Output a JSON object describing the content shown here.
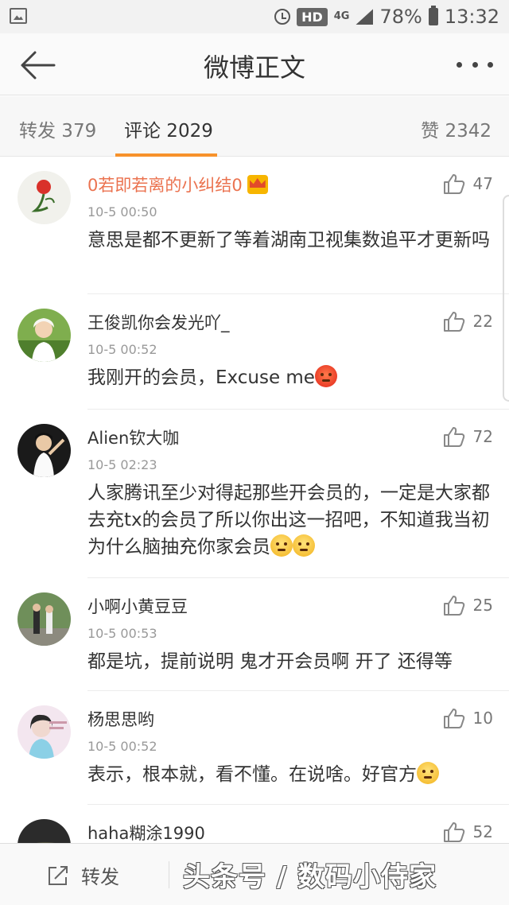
{
  "status_bar": {
    "hd": "HD",
    "network": "4G",
    "battery": "78%",
    "time": "13:32"
  },
  "nav": {
    "title": "微博正文",
    "back_icon": "back-arrow-icon",
    "more_icon": "more-icon"
  },
  "tabs": {
    "forward": "转发 379",
    "comments": "评论 2029",
    "likes": "赞 2342",
    "active": "comments",
    "accent_color": "#f7922b"
  },
  "comments": [
    {
      "user": "0若即若离的小纠结0",
      "vip": true,
      "time": "10-5 00:50",
      "likes": "47",
      "text": "意思是都不更新了等着湖南卫视集数追平才更新吗",
      "emoji": []
    },
    {
      "user": "王俊凯你会发光吖_",
      "vip": false,
      "time": "10-5 00:52",
      "likes": "22",
      "text": "我刚开的会员，Excuse me",
      "emoji": [
        "angry"
      ]
    },
    {
      "user": "Alien钦大咖",
      "vip": false,
      "time": "10-5 02:23",
      "likes": "72",
      "text": "人家腾讯至少对得起那些开会员的，一定是大家都去充tx的会员了所以你出这一招吧，不知道我当初为什么脑抽充你家会员",
      "emoji": [
        "smug",
        "smug"
      ]
    },
    {
      "user": "小啊小黄豆豆",
      "vip": false,
      "time": "10-5 00:53",
      "likes": "25",
      "text": "都是坑，提前说明 鬼才开会员啊  开了 还得等",
      "emoji": []
    },
    {
      "user": "杨思思哟",
      "vip": false,
      "time": "10-5 00:52",
      "likes": "10",
      "text": "表示，根本就，看不懂。在说啥。好官方",
      "emoji": [
        "think"
      ]
    },
    {
      "user": "haha糊涂1990",
      "vip": false,
      "time": "",
      "likes": "52",
      "text": "",
      "emoji": []
    }
  ],
  "bottom_bar": {
    "forward_label": "转发",
    "watermark": "头条号 / 数码小侍家"
  }
}
